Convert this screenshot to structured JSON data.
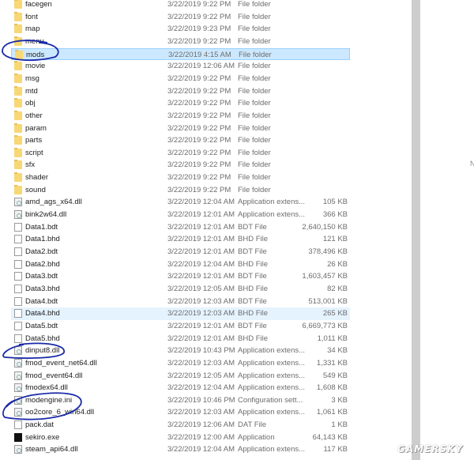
{
  "files": [
    {
      "name": "facegen",
      "date": "3/22/2019 9:22 PM",
      "type": "File folder",
      "size": "",
      "icon": "folder-icon"
    },
    {
      "name": "font",
      "date": "3/22/2019 9:22 PM",
      "type": "File folder",
      "size": "",
      "icon": "folder-icon"
    },
    {
      "name": "map",
      "date": "3/22/2019 9:23 PM",
      "type": "File folder",
      "size": "",
      "icon": "folder-icon"
    },
    {
      "name": "menu",
      "date": "3/22/2019 9:22 PM",
      "type": "File folder",
      "size": "",
      "icon": "folder-icon"
    },
    {
      "name": "mods",
      "date": "3/22/2019 4:15 AM",
      "type": "File folder",
      "size": "",
      "icon": "folder-icon",
      "state": "selected"
    },
    {
      "name": "movie",
      "date": "3/22/2019 12:06 AM",
      "type": "File folder",
      "size": "",
      "icon": "folder-icon"
    },
    {
      "name": "msg",
      "date": "3/22/2019 9:22 PM",
      "type": "File folder",
      "size": "",
      "icon": "folder-icon"
    },
    {
      "name": "mtd",
      "date": "3/22/2019 9:22 PM",
      "type": "File folder",
      "size": "",
      "icon": "folder-icon"
    },
    {
      "name": "obj",
      "date": "3/22/2019 9:22 PM",
      "type": "File folder",
      "size": "",
      "icon": "folder-icon"
    },
    {
      "name": "other",
      "date": "3/22/2019 9:22 PM",
      "type": "File folder",
      "size": "",
      "icon": "folder-icon"
    },
    {
      "name": "param",
      "date": "3/22/2019 9:22 PM",
      "type": "File folder",
      "size": "",
      "icon": "folder-icon"
    },
    {
      "name": "parts",
      "date": "3/22/2019 9:22 PM",
      "type": "File folder",
      "size": "",
      "icon": "folder-icon"
    },
    {
      "name": "script",
      "date": "3/22/2019 9:22 PM",
      "type": "File folder",
      "size": "",
      "icon": "folder-icon"
    },
    {
      "name": "sfx",
      "date": "3/22/2019 9:22 PM",
      "type": "File folder",
      "size": "",
      "icon": "folder-icon"
    },
    {
      "name": "shader",
      "date": "3/22/2019 9:22 PM",
      "type": "File folder",
      "size": "",
      "icon": "folder-icon"
    },
    {
      "name": "sound",
      "date": "3/22/2019 9:22 PM",
      "type": "File folder",
      "size": "",
      "icon": "folder-icon"
    },
    {
      "name": "amd_ags_x64.dll",
      "date": "3/22/2019 12:04 AM",
      "type": "Application extens...",
      "size": "105 KB",
      "icon": "dll-icon"
    },
    {
      "name": "bink2w64.dll",
      "date": "3/22/2019 12:01 AM",
      "type": "Application extens...",
      "size": "366 KB",
      "icon": "dll-icon"
    },
    {
      "name": "Data1.bdt",
      "date": "3/22/2019 12:01 AM",
      "type": "BDT File",
      "size": "2,640,150 KB",
      "icon": "file-icon"
    },
    {
      "name": "Data1.bhd",
      "date": "3/22/2019 12:01 AM",
      "type": "BHD File",
      "size": "121 KB",
      "icon": "file-icon"
    },
    {
      "name": "Data2.bdt",
      "date": "3/22/2019 12:01 AM",
      "type": "BDT File",
      "size": "378,496 KB",
      "icon": "file-icon"
    },
    {
      "name": "Data2.bhd",
      "date": "3/22/2019 12:04 AM",
      "type": "BHD File",
      "size": "26 KB",
      "icon": "file-icon"
    },
    {
      "name": "Data3.bdt",
      "date": "3/22/2019 12:01 AM",
      "type": "BDT File",
      "size": "1,603,457 KB",
      "icon": "file-icon"
    },
    {
      "name": "Data3.bhd",
      "date": "3/22/2019 12:05 AM",
      "type": "BHD File",
      "size": "82 KB",
      "icon": "file-icon"
    },
    {
      "name": "Data4.bdt",
      "date": "3/22/2019 12:03 AM",
      "type": "BDT File",
      "size": "513,001 KB",
      "icon": "file-icon"
    },
    {
      "name": "Data4.bhd",
      "date": "3/22/2019 12:03 AM",
      "type": "BHD File",
      "size": "265 KB",
      "icon": "file-icon",
      "state": "hover"
    },
    {
      "name": "Data5.bdt",
      "date": "3/22/2019 12:01 AM",
      "type": "BDT File",
      "size": "6,669,773 KB",
      "icon": "file-icon"
    },
    {
      "name": "Data5.bhd",
      "date": "3/22/2019 12:01 AM",
      "type": "BHD File",
      "size": "1,011 KB",
      "icon": "file-icon"
    },
    {
      "name": "dinput8.dll",
      "date": "3/22/2019 10:43 PM",
      "type": "Application extens...",
      "size": "34 KB",
      "icon": "dll-icon"
    },
    {
      "name": "fmod_event_net64.dll",
      "date": "3/22/2019 12:03 AM",
      "type": "Application extens...",
      "size": "1,331 KB",
      "icon": "dll-icon"
    },
    {
      "name": "fmod_event64.dll",
      "date": "3/22/2019 12:05 AM",
      "type": "Application extens...",
      "size": "549 KB",
      "icon": "dll-icon"
    },
    {
      "name": "fmodex64.dll",
      "date": "3/22/2019 12:04 AM",
      "type": "Application extens...",
      "size": "1,608 KB",
      "icon": "dll-icon"
    },
    {
      "name": "modengine.ini",
      "date": "3/22/2019 10:46 PM",
      "type": "Configuration sett...",
      "size": "3 KB",
      "icon": "dll-icon"
    },
    {
      "name": "oo2core_6_win64.dll",
      "date": "3/22/2019 12:03 AM",
      "type": "Application extens...",
      "size": "1,061 KB",
      "icon": "dll-icon"
    },
    {
      "name": "pack.dat",
      "date": "3/22/2019 12:06 AM",
      "type": "DAT File",
      "size": "1 KB",
      "icon": "file-icon"
    },
    {
      "name": "sekiro.exe",
      "date": "3/22/2019 12:00 AM",
      "type": "Application",
      "size": "64,143 KB",
      "icon": "exe-icon"
    },
    {
      "name": "steam_api64.dll",
      "date": "3/22/2019 12:04 AM",
      "type": "Application extens...",
      "size": "117 KB",
      "icon": "dll-icon"
    }
  ],
  "side_panel": {
    "label": "N"
  },
  "watermark": "GAMERSKY",
  "colors": {
    "selected": "#cce8ff",
    "hover": "#e5f3ff",
    "annotation": "#1a2aa8"
  }
}
